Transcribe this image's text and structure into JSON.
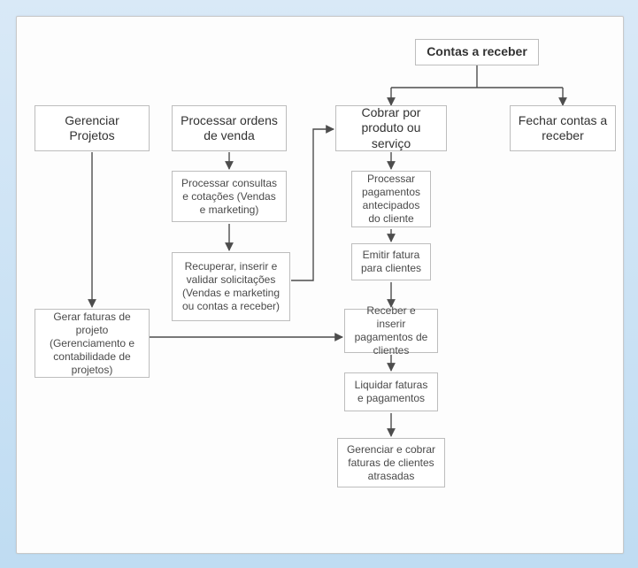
{
  "title_node": {
    "label": "Contas a receber"
  },
  "columns": {
    "gerenciar_projetos": {
      "head": "Gerenciar Projetos",
      "sub1": "Gerar faturas de projeto (Gerenciamento e contabilidade de projetos)"
    },
    "processar_ordens": {
      "head": "Processar ordens de venda",
      "sub1": "Processar consultas e cotações (Vendas e marketing)",
      "sub2": "Recuperar, inserir e validar solicitações (Vendas e marketing ou contas a receber)"
    },
    "cobrar": {
      "head": "Cobrar por produto ou serviço",
      "sub1": "Processar pagamentos antecipados do cliente",
      "sub2": "Emitir fatura para clientes",
      "sub3": "Receber e inserir pagamentos de clientes",
      "sub4": "Liquidar faturas e pagamentos",
      "sub5": "Gerenciar e cobrar faturas de clientes atrasadas"
    },
    "fechar": {
      "head": "Fechar contas a receber"
    }
  }
}
